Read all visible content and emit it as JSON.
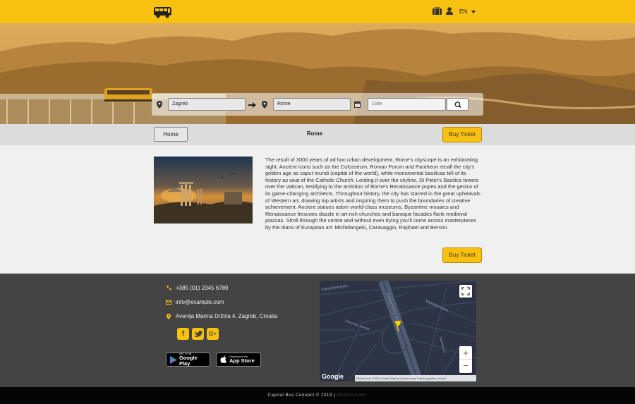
{
  "header": {
    "logo_icon": "bus-icon",
    "language": "EN",
    "icons": [
      "luggage-icon",
      "user-icon"
    ],
    "accent": "#f8c10f"
  },
  "search": {
    "from_value": "Zagreb",
    "to_value": "Rome",
    "date_placeholder": "Date",
    "icons": [
      "map-marker-icon",
      "arrow-right-icon",
      "calendar-icon",
      "search-icon"
    ]
  },
  "nav": {
    "home_label": "Home",
    "title": "Rome",
    "buy_label": "Buy Ticket"
  },
  "city": {
    "description": "The result of 3000 years of ad hoc urban development, Rome's cityscape is an exhilarating sight. Ancient icons such as the Colosseum, Roman Forum and Pantheon recall the city's golden age as caput mundi (capital of the world), while monumental basilicas tell of its history as seat of the Catholic Church. Lording it over the skyline, St Peter's Basilica towers over the Vatican, testifying to the ambition of Rome's Renaissance popes and the genius of its game-changing architects. Throughout history, the city has starred in the great upheavals of Western art, drawing top artists and inspiring them to push the boundaries of creative achievement. Ancient statues adorn world-class museums, Byzantine mosaics and Renaissance frescoes dazzle in art-rich churches and baroque facades flank medieval piazzas. Stroll through the centre and without even trying you'll come across masterpieces by the titans of European art: Michelangelo, Caravaggio, Raphael and Bernini.",
    "buy_label": "Buy Ticket"
  },
  "footer": {
    "phone": "+385 (01) 2345 6789",
    "email": "info@example.com",
    "address": "Avenija Marina Držića 4, Zagreb, Croatia",
    "social": [
      "f",
      "t",
      "G+"
    ],
    "google_play": {
      "small": "GET IT ON",
      "big": "Google Play"
    },
    "app_store": {
      "small": "Download on the",
      "big": "App Store"
    },
    "map": {
      "streets": [
        "Kneza Branimira",
        "Avenija Marina Držića",
        "Radnička cesta",
        "Slavonska avenija",
        "Šubićeva ul."
      ],
      "logo": "Google",
      "attribution": "Podaci karte ©2019 Google   Uvjeti pružanja usluge   Prijavi pogrešku na karti",
      "zoom_in": "+",
      "zoom_out": "−"
    }
  },
  "copyright": {
    "text": "Capital Bus Connect © 2019 |",
    "admin": "Administrator"
  }
}
